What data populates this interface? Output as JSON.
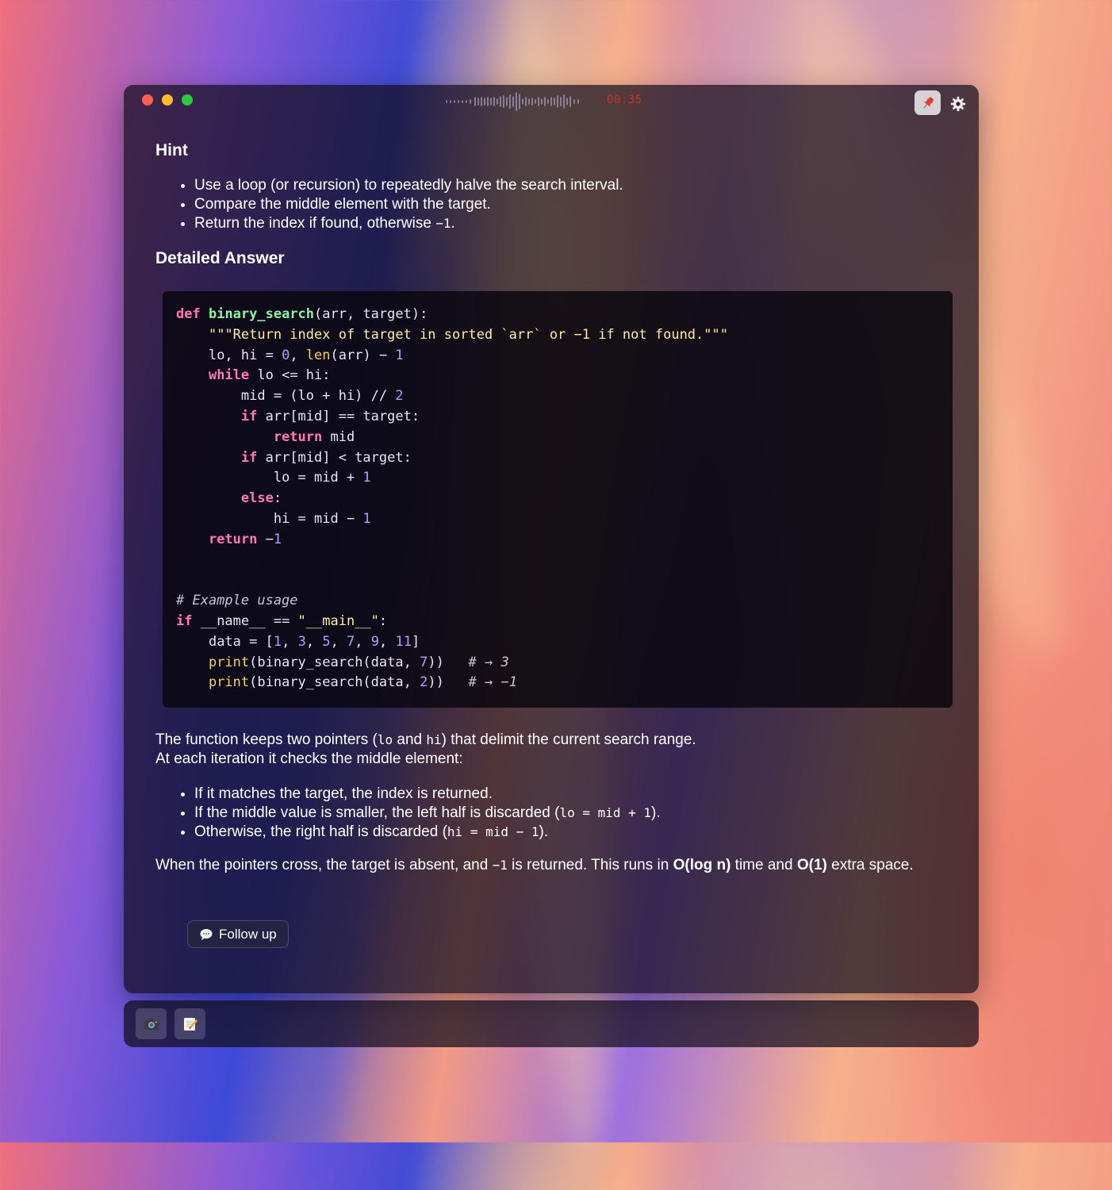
{
  "window": {
    "timer": "00:35"
  },
  "hint": {
    "title": "Hint",
    "items": [
      "Use a loop (or recursion) to repeatedly halve the search interval.",
      "Compare the middle element with the target.",
      "Return the index if found, otherwise "
    ],
    "item3_code": "−1",
    "item3_end": "."
  },
  "answer": {
    "title": "Detailed Answer",
    "para1_a": "The function keeps two pointers (",
    "para1_code1": "lo",
    "para1_b": " and ",
    "para1_code2": "hi",
    "para1_c": ") that delimit the current search range.",
    "para1_line2": "At each iteration it checks the middle element:",
    "list": {
      "item1": "If it matches the target, the index is returned.",
      "item2_a": "If the middle value is smaller, the left half is discarded (",
      "item2_code": "lo = mid + 1",
      "item2_b": ").",
      "item3_a": "Otherwise, the right half is discarded (",
      "item3_code": "hi = mid − 1",
      "item3_b": ")."
    },
    "para3_a": "When the pointers cross, the target is absent, and ",
    "para3_code": "−1",
    "para3_b": " is returned. This runs in ",
    "para3_bold1": "O(log n)",
    "para3_c": " time and ",
    "para3_bold2": "O(1)",
    "para3_d": " extra space."
  },
  "code": {
    "l1_def": "def",
    "l1_fn": "binary_search",
    "l1_rest": "(arr, target):",
    "l2_str": "\"\"\"Return index of target in sorted `arr` or −1 if not found.\"\"\"",
    "l3_a": "lo, hi = ",
    "l3_n0": "0",
    "l3_b": ", ",
    "l3_len": "len",
    "l3_c": "(arr) − ",
    "l3_n1": "1",
    "l4_kw": "while",
    "l4_rest": " lo <= hi:",
    "l5_a": "mid = (lo + hi) // ",
    "l5_n": "2",
    "l6_kw": "if",
    "l6_rest": " arr[mid] == target:",
    "l7_kw": "return",
    "l7_rest": " mid",
    "l8_kw": "if",
    "l8_rest": " arr[mid] < target:",
    "l9_a": "lo = mid + ",
    "l9_n": "1",
    "l10_kw": "else",
    "l10_rest": ":",
    "l11_a": "hi = mid − ",
    "l11_n": "1",
    "l12_kw": "return",
    "l12_rest": " −",
    "l12_n": "1",
    "l13_cm": "# Example usage",
    "l14_kw": "if",
    "l14_a": " __name__ == ",
    "l14_str": "\"__main__\"",
    "l14_b": ":",
    "l15_a": "data = [",
    "l15_n1": "1",
    "l15_n2": "3",
    "l15_n3": "5",
    "l15_n4": "7",
    "l15_n5": "9",
    "l15_n6": "11",
    "l15_b": "]",
    "l16_print": "print",
    "l16_a": "(binary_search(data, ",
    "l16_n": "7",
    "l16_b": "))",
    "l16_cm": "# → 3",
    "l17_print": "print",
    "l17_a": "(binary_search(data, ",
    "l17_n": "2",
    "l17_b": "))",
    "l17_cm": "# → −1"
  },
  "follow_up": {
    "label": "Follow up",
    "icon": "speech-bubble-icon"
  },
  "toolbar": {
    "icons": [
      "camera-icon",
      "memo-icon"
    ]
  }
}
